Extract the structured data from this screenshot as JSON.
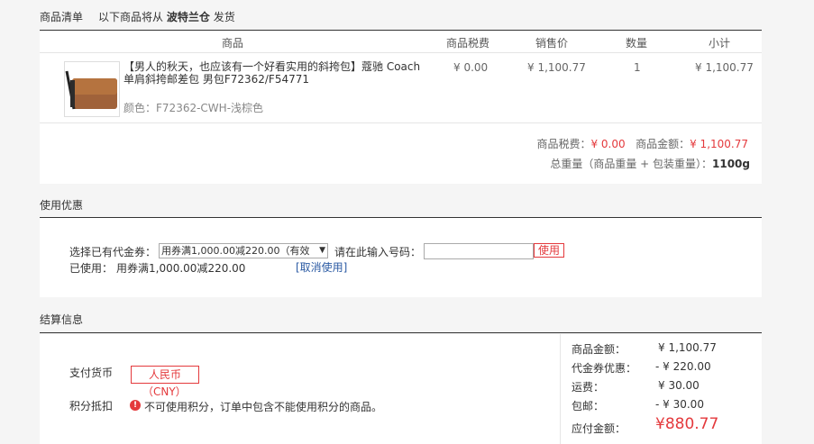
{
  "header": {
    "title": "商品清单",
    "ship_prefix": "以下商品将从",
    "warehouse": "波特兰仓",
    "ship_suffix": "发货"
  },
  "table": {
    "columns": [
      "商品",
      "商品税费",
      "销售价",
      "数量",
      "小计"
    ],
    "item": {
      "name_line1": "【男人的秋天，也应该有一个好看实用的斜挎包】蔻驰 Coach",
      "name_line2": "单肩斜挎邮差包 男包F72362/F54771",
      "color_label": "颜色：",
      "color_value": "F72362-CWH-浅棕色",
      "tax": "¥ 0.00",
      "price": "¥ 1,100.77",
      "qty": "1",
      "subtotal": "¥ 1,100.77"
    },
    "summary": {
      "tax_label": "商品税费：",
      "tax_value": "¥ 0.00",
      "amount_label": "商品金额：",
      "amount_value": "¥ 1,100.77",
      "weight_label": "总重量（商品重量 + 包装重量）：",
      "weight_value": "1100g"
    }
  },
  "coupon": {
    "title": "使用优惠",
    "select_label": "选择已有代金券：",
    "select_value": "用券满1,000.00减220.00（有效",
    "input_label": "请在此输入号码：",
    "input_value": "",
    "use_button": "使用",
    "used_label": "已使用：",
    "used_value": "用券满1,000.00减220.00",
    "cancel_link": "[取消使用]"
  },
  "checkout": {
    "title": "结算信息",
    "currency_label": "支付货币",
    "currency_value": "人民币",
    "currency_code": "（CNY）",
    "points_label": "积分抵扣",
    "points_warning": "不可使用积分，订单中包含不能使用积分的商品。",
    "lines": [
      {
        "label": "商品金额：",
        "value": "¥ 1,100.77"
      },
      {
        "label": "代金券优惠：",
        "value": "- ¥ 220.00"
      },
      {
        "label": "运费：",
        "value": "¥ 30.00"
      },
      {
        "label": "包邮：",
        "value": "- ¥ 30.00"
      }
    ],
    "payable_label": "应付金额：",
    "payable_value": "¥880.77"
  }
}
